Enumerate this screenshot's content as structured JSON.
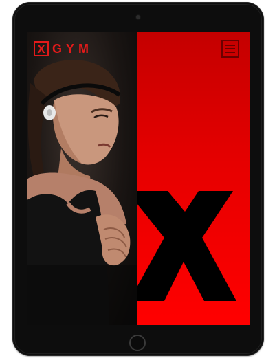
{
  "app": {
    "brand": {
      "box_letter": "X",
      "word": "GYM",
      "color": "#e21a1a"
    },
    "menu": {
      "icon": "hamburger-menu-icon"
    },
    "hero": {
      "photo": "woman-athlete-photo",
      "big_letter": "X",
      "accent_color": "#ff0000"
    }
  }
}
